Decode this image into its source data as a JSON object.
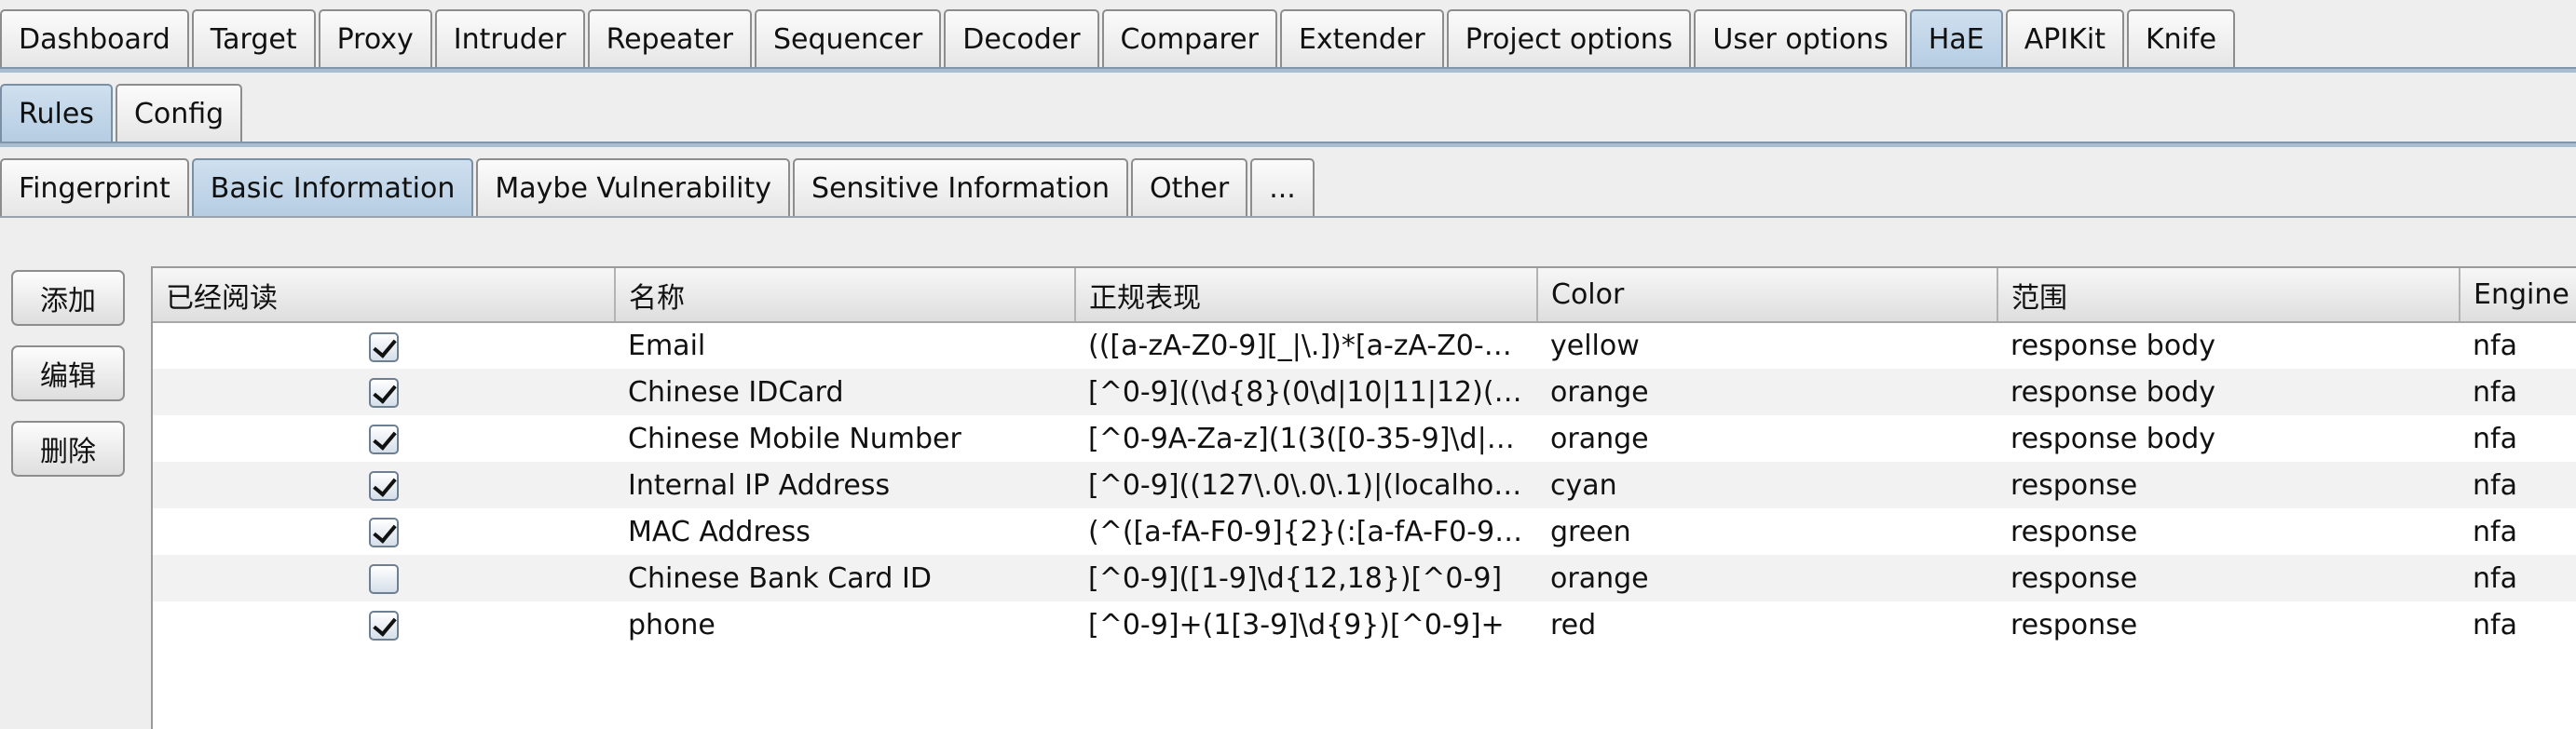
{
  "main_tabs": [
    {
      "label": "Dashboard",
      "active": false
    },
    {
      "label": "Target",
      "active": false
    },
    {
      "label": "Proxy",
      "active": false
    },
    {
      "label": "Intruder",
      "active": false
    },
    {
      "label": "Repeater",
      "active": false
    },
    {
      "label": "Sequencer",
      "active": false
    },
    {
      "label": "Decoder",
      "active": false
    },
    {
      "label": "Comparer",
      "active": false
    },
    {
      "label": "Extender",
      "active": false
    },
    {
      "label": "Project options",
      "active": false
    },
    {
      "label": "User options",
      "active": false
    },
    {
      "label": "HaE",
      "active": true
    },
    {
      "label": "APIKit",
      "active": false
    },
    {
      "label": "Knife",
      "active": false
    }
  ],
  "rules_tabs": [
    {
      "label": "Rules",
      "active": true
    },
    {
      "label": "Config",
      "active": false
    }
  ],
  "category_tabs": [
    {
      "label": "Fingerprint",
      "active": false
    },
    {
      "label": "Basic Information",
      "active": true
    },
    {
      "label": "Maybe Vulnerability",
      "active": false
    },
    {
      "label": "Sensitive Information",
      "active": false
    },
    {
      "label": "Other",
      "active": false
    },
    {
      "label": "...",
      "active": false
    }
  ],
  "side_buttons": {
    "add": "添加",
    "edit": "编辑",
    "delete": "删除"
  },
  "table": {
    "headers": {
      "read": "已经阅读",
      "name": "名称",
      "regex": "正规表现",
      "color": "Color",
      "scope": "范围",
      "engine": "Engine"
    },
    "rows": [
      {
        "checked": true,
        "name": "Email",
        "regex": "(([a-zA-Z0-9][_|\\.])*[a-zA-Z0-9]...",
        "color": "yellow",
        "scope": "response body",
        "engine": "nfa"
      },
      {
        "checked": true,
        "name": "Chinese IDCard",
        "regex": "[^0-9]((\\d{8}(0\\d|10|11|12)([0-2]\\...",
        "color": "orange",
        "scope": "response body",
        "engine": "nfa"
      },
      {
        "checked": true,
        "name": "Chinese Mobile Number",
        "regex": "[^0-9A-Za-z](1(3([0-35-9]\\d|4[1-...",
        "color": "orange",
        "scope": "response body",
        "engine": "nfa"
      },
      {
        "checked": true,
        "name": "Internal IP Address",
        "regex": "[^0-9]((127\\.0\\.0\\.1)|(localhost)|...",
        "color": "cyan",
        "scope": "response",
        "engine": "nfa"
      },
      {
        "checked": true,
        "name": "MAC Address",
        "regex": "(^([a-fA-F0-9]{2}(:[a-fA-F0-9]{2}...",
        "color": "green",
        "scope": "response",
        "engine": "nfa"
      },
      {
        "checked": false,
        "name": "Chinese Bank Card ID",
        "regex": "[^0-9]([1-9]\\d{12,18})[^0-9]",
        "color": "orange",
        "scope": "response",
        "engine": "nfa"
      },
      {
        "checked": true,
        "name": "phone",
        "regex": "[^0-9]+(1[3-9]\\d{9})[^0-9]+",
        "color": "red",
        "scope": "response",
        "engine": "nfa"
      }
    ]
  }
}
